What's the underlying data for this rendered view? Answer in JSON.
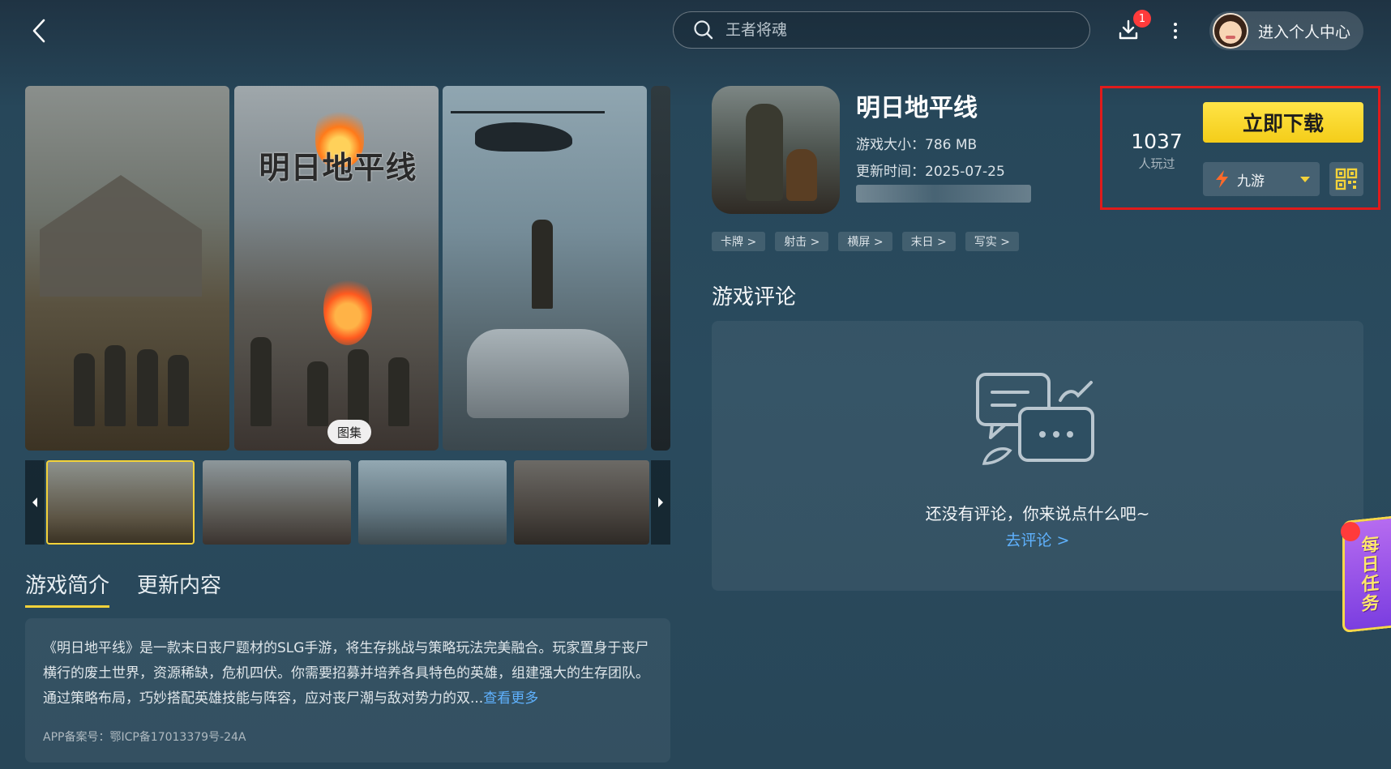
{
  "topbar": {
    "search_placeholder": "王者将魂",
    "download_badge": "1",
    "user_center_label": "进入个人中心"
  },
  "gallery": {
    "tag_label": "图集",
    "poster_logo_text": "明日地平线",
    "thumb_count": 4,
    "active_thumb": 1
  },
  "tabs": [
    {
      "label": "游戏简介",
      "active": true
    },
    {
      "label": "更新内容",
      "active": false
    }
  ],
  "description": {
    "text": "《明日地平线》是一款末日丧尸题材的SLG手游，将生存挑战与策略玩法完美融合。玩家置身于丧尸横行的废土世界，资源稀缺，危机四伏。你需要招募并培养各具特色的英雄，组建强大的生存团队。通过策略布局，巧妙搭配英雄技能与阵容，应对丧尸潮与敌对势力的双...",
    "see_more": "查看更多",
    "icp": "APP备案号：鄂ICP备17013379号-24A"
  },
  "app": {
    "title": "明日地平线",
    "size": "游戏大小：786 MB",
    "update": "更新时间：2025-07-25",
    "tags": [
      "卡牌 >",
      "射击 >",
      "横屏 >",
      "末日 >",
      "写实 >"
    ]
  },
  "download_panel": {
    "play_count": "1037",
    "play_label": "人玩过",
    "download_label": "立即下载",
    "channel_name": "九游"
  },
  "comments": {
    "section_title": "游戏评论",
    "empty_text": "还没有评论，你来说点什么吧~",
    "link_label": "去评论 >"
  },
  "daily_task": {
    "label": "每日任务"
  },
  "colors": {
    "accent_yellow": "#f4cd19",
    "link_blue": "#5fb2ff",
    "highlight_red": "#e01b1b"
  }
}
